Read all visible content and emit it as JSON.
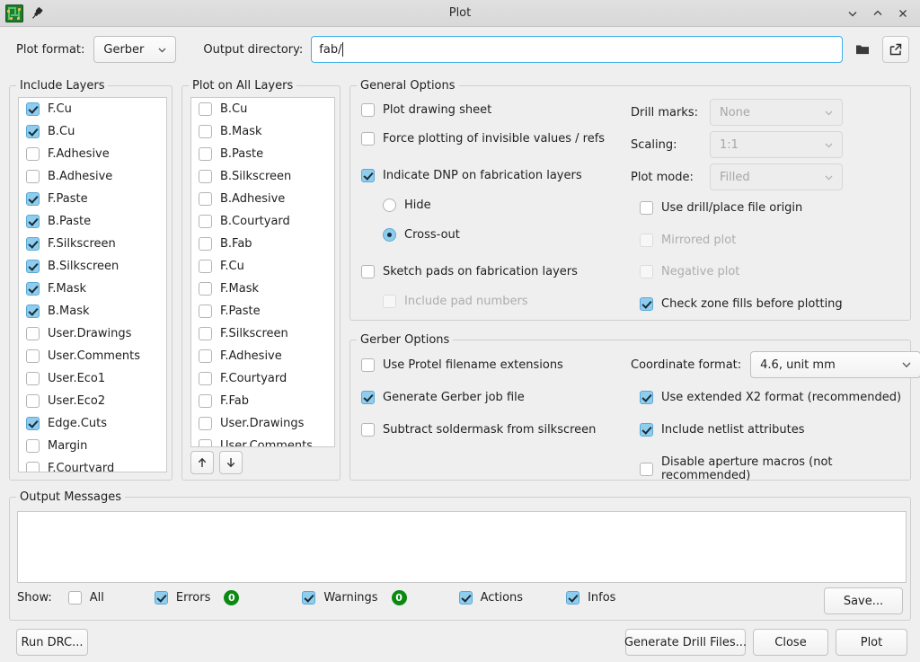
{
  "window": {
    "title": "Plot",
    "icon": "kicad-pcb-icon",
    "pin_icon": "pin-icon",
    "controls": [
      {
        "name": "minimize-button",
        "glyph": "chevron-down-icon"
      },
      {
        "name": "maximize-button",
        "glyph": "chevron-up-icon"
      },
      {
        "name": "close-button",
        "glyph": "close-icon"
      }
    ]
  },
  "toolbar": {
    "plot_format_label": "Plot format:",
    "plot_format_value": "Gerber",
    "output_directory_label": "Output directory:",
    "output_directory_value": "fab/",
    "browse_icon": "folder-icon",
    "open_icon": "external-link-icon"
  },
  "include_layers": {
    "legend": "Include Layers",
    "items": [
      {
        "label": "F.Cu",
        "checked": true
      },
      {
        "label": "B.Cu",
        "checked": true
      },
      {
        "label": "F.Adhesive",
        "checked": false
      },
      {
        "label": "B.Adhesive",
        "checked": false
      },
      {
        "label": "F.Paste",
        "checked": true
      },
      {
        "label": "B.Paste",
        "checked": true
      },
      {
        "label": "F.Silkscreen",
        "checked": true
      },
      {
        "label": "B.Silkscreen",
        "checked": true
      },
      {
        "label": "F.Mask",
        "checked": true
      },
      {
        "label": "B.Mask",
        "checked": true
      },
      {
        "label": "User.Drawings",
        "checked": false
      },
      {
        "label": "User.Comments",
        "checked": false
      },
      {
        "label": "User.Eco1",
        "checked": false
      },
      {
        "label": "User.Eco2",
        "checked": false
      },
      {
        "label": "Edge.Cuts",
        "checked": true
      },
      {
        "label": "Margin",
        "checked": false
      },
      {
        "label": "F.Courtyard",
        "checked": false
      }
    ]
  },
  "plot_on_all_layers": {
    "legend": "Plot on All Layers",
    "items": [
      {
        "label": "B.Cu",
        "checked": false
      },
      {
        "label": "B.Mask",
        "checked": false
      },
      {
        "label": "B.Paste",
        "checked": false
      },
      {
        "label": "B.Silkscreen",
        "checked": false
      },
      {
        "label": "B.Adhesive",
        "checked": false
      },
      {
        "label": "B.Courtyard",
        "checked": false
      },
      {
        "label": "B.Fab",
        "checked": false
      },
      {
        "label": "F.Cu",
        "checked": false
      },
      {
        "label": "F.Mask",
        "checked": false
      },
      {
        "label": "F.Paste",
        "checked": false
      },
      {
        "label": "F.Silkscreen",
        "checked": false
      },
      {
        "label": "F.Adhesive",
        "checked": false
      },
      {
        "label": "F.Courtyard",
        "checked": false
      },
      {
        "label": "F.Fab",
        "checked": false
      },
      {
        "label": "User.Drawings",
        "checked": false
      },
      {
        "label": "User.Comments",
        "checked": false
      }
    ],
    "move_up_icon": "arrow-up-icon",
    "move_down_icon": "arrow-down-icon"
  },
  "general_options": {
    "legend": "General Options",
    "plot_drawing_sheet": {
      "label": "Plot drawing sheet",
      "checked": false
    },
    "force_plotting_invisible": {
      "label": "Force plotting of invisible values / refs",
      "checked": false
    },
    "indicate_dnp": {
      "label": "Indicate DNP on fabrication layers",
      "checked": true
    },
    "dnp_hide": {
      "label": "Hide",
      "selected": false
    },
    "dnp_crossout": {
      "label": "Cross-out",
      "selected": true
    },
    "sketch_pads": {
      "label": "Sketch pads on fabrication layers",
      "checked": false
    },
    "include_pad_numbers": {
      "label": "Include pad numbers",
      "checked": false,
      "disabled": true
    },
    "drill_marks_label": "Drill marks:",
    "drill_marks_value": "None",
    "drill_marks_disabled": true,
    "scaling_label": "Scaling:",
    "scaling_value": "1:1",
    "scaling_disabled": true,
    "plot_mode_label": "Plot mode:",
    "plot_mode_value": "Filled",
    "plot_mode_disabled": true,
    "use_drill_place_origin": {
      "label": "Use drill/place file origin",
      "checked": false
    },
    "mirrored_plot": {
      "label": "Mirrored plot",
      "checked": false,
      "disabled": true
    },
    "negative_plot": {
      "label": "Negative plot",
      "checked": false,
      "disabled": true
    },
    "check_zone_fills": {
      "label": "Check zone fills before plotting",
      "checked": true
    }
  },
  "gerber_options": {
    "legend": "Gerber Options",
    "use_protel_ext": {
      "label": "Use Protel filename extensions",
      "checked": false
    },
    "generate_job_file": {
      "label": "Generate Gerber job file",
      "checked": true
    },
    "subtract_soldermask": {
      "label": "Subtract soldermask from silkscreen",
      "checked": false
    },
    "coordinate_format_label": "Coordinate format:",
    "coordinate_format_value": "4.6, unit mm",
    "use_x2": {
      "label": "Use extended X2 format (recommended)",
      "checked": true
    },
    "include_netlist_attrs": {
      "label": "Include netlist attributes",
      "checked": true
    },
    "disable_aperture_macros": {
      "label": "Disable aperture macros (not recommended)",
      "checked": false
    }
  },
  "output_messages": {
    "legend": "Output Messages",
    "content": "",
    "show_label": "Show:",
    "filters": [
      {
        "label": "All",
        "checked": false,
        "count": null
      },
      {
        "label": "Errors",
        "checked": true,
        "count": "0"
      },
      {
        "label": "Warnings",
        "checked": true,
        "count": "0"
      },
      {
        "label": "Actions",
        "checked": true,
        "count": null
      },
      {
        "label": "Infos",
        "checked": true,
        "count": null
      }
    ],
    "save_label": "Save..."
  },
  "footer": {
    "run_drc_label": "Run DRC...",
    "generate_drill_files_label": "Generate Drill Files...",
    "close_label": "Close",
    "plot_label": "Plot"
  },
  "colors": {
    "accent": "#3daee9",
    "checkbox_on": "#8fcdef",
    "badge_green": "#0a8a11",
    "window_bg": "#efefef",
    "titlebar": "#dcdcdc"
  }
}
